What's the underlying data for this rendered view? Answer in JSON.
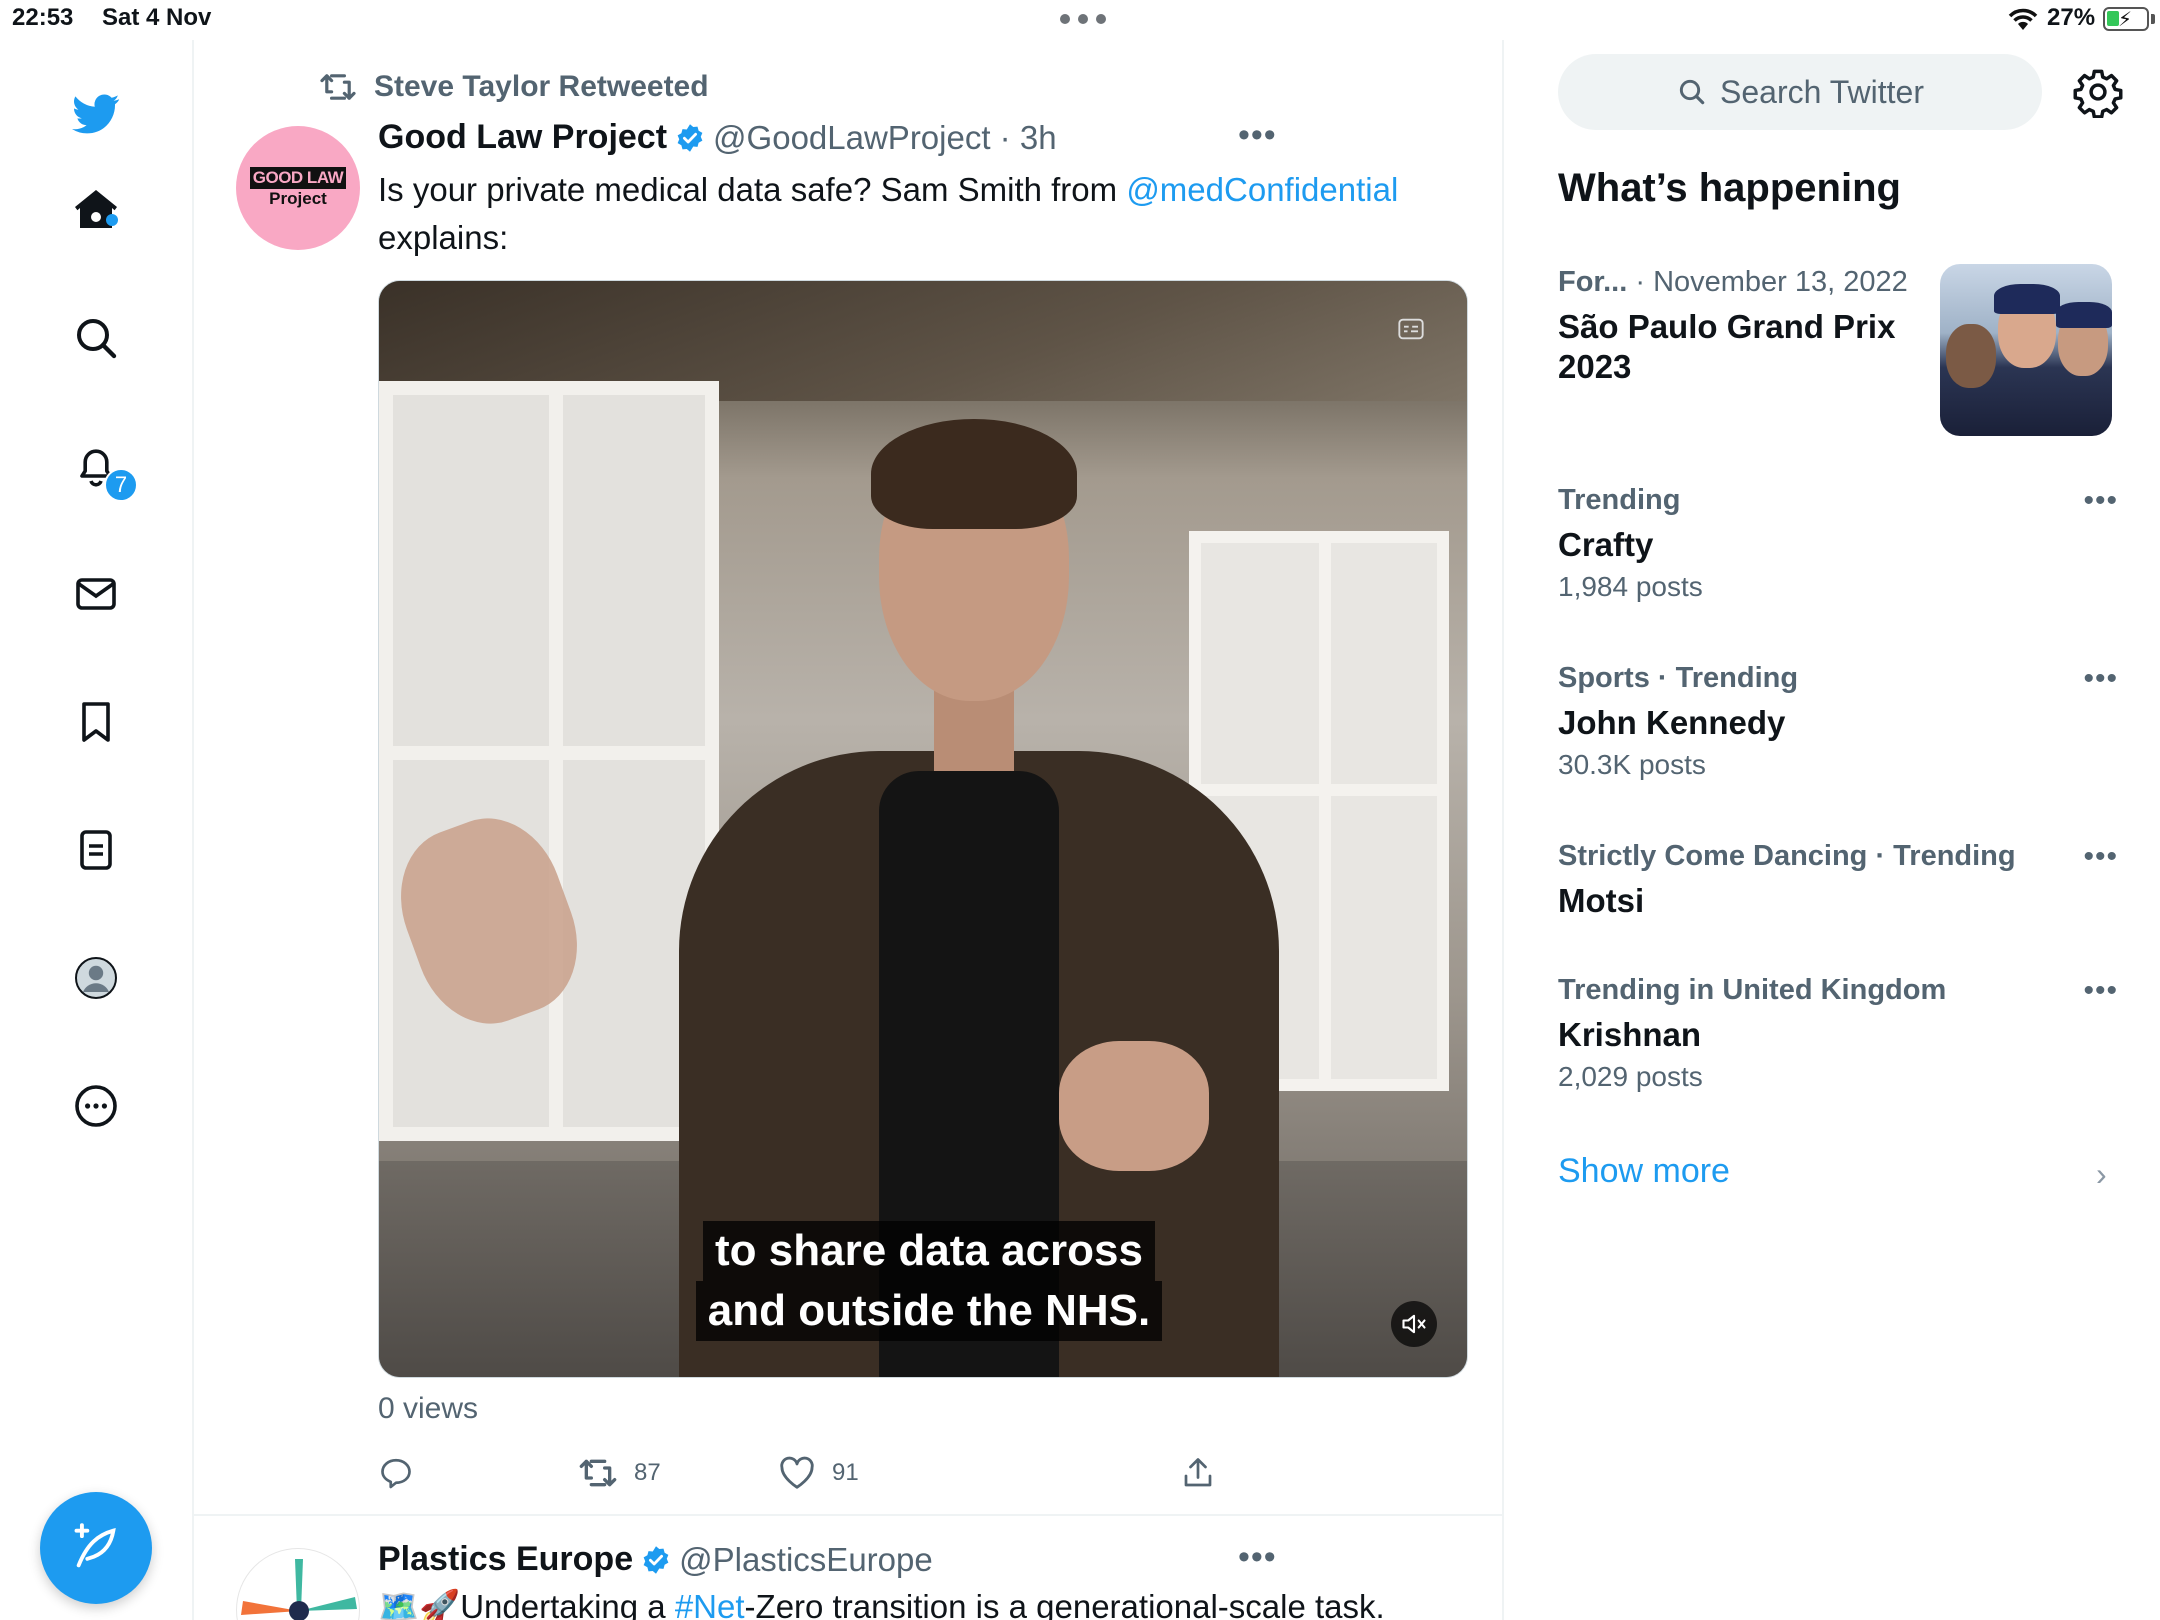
{
  "status_bar": {
    "time": "22:53",
    "date": "Sat 4 Nov",
    "battery": "27%",
    "icons": [
      "wifi-icon",
      "battery-charging-icon"
    ]
  },
  "sidebar": {
    "items": [
      {
        "name": "twitter-logo-icon"
      },
      {
        "name": "home-icon"
      },
      {
        "name": "search-icon"
      },
      {
        "name": "notifications-icon",
        "badge": "7"
      },
      {
        "name": "messages-icon"
      },
      {
        "name": "bookmarks-icon"
      },
      {
        "name": "lists-icon"
      },
      {
        "name": "profile-icon"
      },
      {
        "name": "more-icon"
      }
    ],
    "compose_icon": "compose-icon"
  },
  "timeline": {
    "retweeted_by": "Steve Taylor Retweeted",
    "tweet": {
      "avatar_text_1": "GOOD LAW",
      "avatar_text_2": "Project",
      "name": "Good Law Project",
      "handle_time": "@GoodLawProject · 3h",
      "text_before": "Is your private medical data safe? Sam Smith from ",
      "mention": "@medConfidential",
      "text_after": " explains:",
      "caption_1": "to share data across",
      "caption_2": "and outside the NHS.",
      "views": "0 views",
      "retweets": "87",
      "likes": "91"
    },
    "tweet2": {
      "name": "Plastics Europe",
      "handle": "@PlasticsEurope",
      "emoji": "🗺️🚀",
      "text_before": "Undertaking a ",
      "hashtag": "#Net",
      "text_after": "-Zero transition is a generational-scale task."
    }
  },
  "right_column": {
    "search_placeholder": "Search Twitter",
    "heading": "What’s happening",
    "event": {
      "meta_category": "For...",
      "meta_date": " · November 13, 2022",
      "title": "São Paulo Grand Prix 2023"
    },
    "trends": [
      {
        "meta": "Trending",
        "title": "Crafty",
        "count": "1,984 posts"
      },
      {
        "meta": "Sports · Trending",
        "title": "John Kennedy",
        "count": "30.3K posts"
      },
      {
        "meta": "Strictly Come Dancing · Trending",
        "title": "Motsi",
        "count": ""
      },
      {
        "meta": "Trending in United Kingdom",
        "title": "Krishnan",
        "count": "2,029 posts"
      }
    ],
    "show_more": "Show more"
  },
  "colors": {
    "accent": "#1d9bf0",
    "secondary_text": "#536471",
    "primary_text": "#0f1419"
  }
}
